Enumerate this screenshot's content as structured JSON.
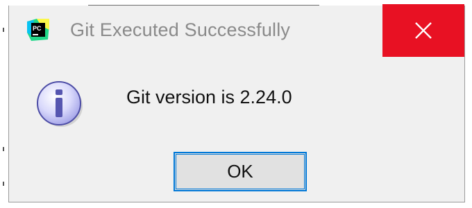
{
  "dialog": {
    "title": "Git Executed Successfully",
    "app_icon": "pycharm-icon",
    "app_icon_text": "PC",
    "close_icon": "close-icon",
    "message_icon": "info-icon",
    "message": "Git version is 2.24.0",
    "ok_label": "OK"
  },
  "colors": {
    "close_button": "#e81123",
    "focus_border": "#0078d7",
    "dialog_background": "#f0f0f0",
    "title_text": "#8a8a8a"
  }
}
